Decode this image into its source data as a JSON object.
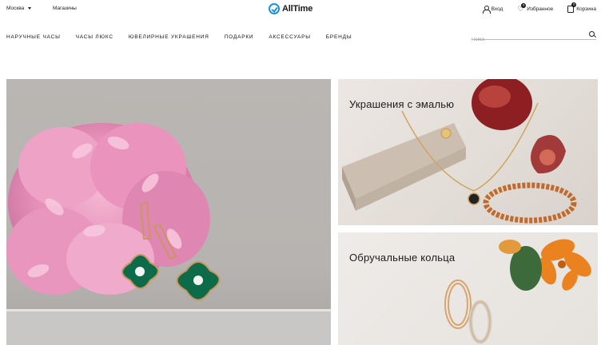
{
  "header": {
    "city": "Москва",
    "stores_link": "Магазины",
    "logo_text": "AllTime",
    "login_label": "Вход",
    "favorites_label": "Избранное",
    "favorites_count": "0",
    "cart_label": "Корзина",
    "cart_count": "0"
  },
  "nav": {
    "items": [
      "НАРУЧНЫЕ ЧАСЫ",
      "ЧАСЫ ЛЮКС",
      "ЮВЕЛИРНЫЕ УКРАШЕНИЯ",
      "ПОДАРКИ",
      "АКСЕССУАРЫ",
      "БРЕНДЫ"
    ]
  },
  "search": {
    "placeholder": "Поиск"
  },
  "banners": [
    {
      "title": ""
    },
    {
      "title": "Украшения с эмалью"
    },
    {
      "title": "Обручальные кольца"
    }
  ],
  "colors": {
    "brand": "#1a93d6"
  },
  "icons": [
    "chevron-down-icon",
    "user-icon",
    "heart-icon",
    "bag-icon",
    "search-icon",
    "logo-clock-icon"
  ]
}
